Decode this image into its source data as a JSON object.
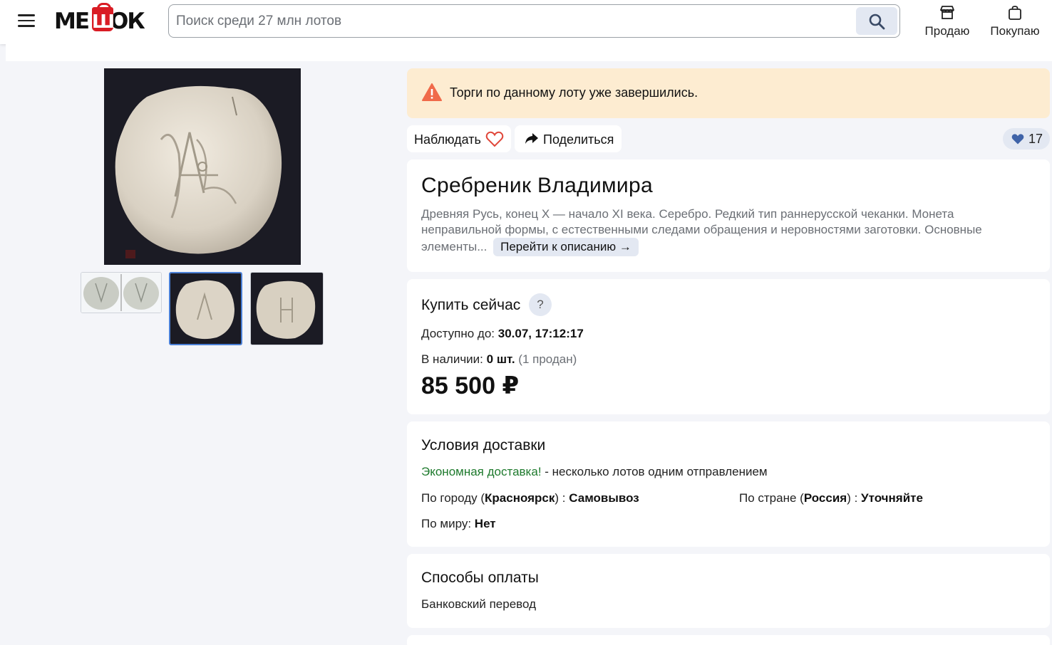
{
  "header": {
    "logo": "МЕШОК",
    "search_placeholder": "Поиск среди 27 млн лотов",
    "sell_label": "Продаю",
    "buy_label": "Покупаю"
  },
  "lot": {
    "alert": "Торги по данному лоту уже завершились.",
    "watch_label": "Наблюдать",
    "share_label": "Поделиться",
    "likes_count": "17",
    "title": "Сребреник Владимира",
    "description": "Древняя Русь, конец X — начало XI века. Серебро. Редкий тип раннерусской чеканки. Монета неправильной формы, с естественными следами обращения и неровностями заготовки. Основные элементы...",
    "description_link": "Перейти к описанию →"
  },
  "buy_now": {
    "heading": "Купить сейчас",
    "help": "?",
    "available_until_label": "Доступно до:",
    "available_until_value": "30.07, 17:12:17",
    "in_stock_label": "В наличии:",
    "in_stock_value": "0 шт.",
    "sold_note": "(1 продан)",
    "price": "85 500 ₽"
  },
  "delivery": {
    "heading": "Условия доставки",
    "economy_highlight": "Экономная доставка!",
    "economy_rest": " - несколько лотов одним отправлением",
    "city_prefix": "По городу (",
    "city_name": "Красноярск",
    "city_suffix": ") : ",
    "city_value": "Самовывоз",
    "country_prefix": "По стране (",
    "country_name": "Россия",
    "country_suffix": ") : ",
    "country_value": "Уточняйте",
    "world_label": "По миру: ",
    "world_value": "Нет"
  },
  "payment": {
    "heading": "Способы оплаты",
    "method": "Банковский перевод"
  },
  "colors": {
    "accent_bag": "#d91c24",
    "alert_bg": "#fdecd1",
    "alert_icon": "#f06a4a",
    "heart_outline": "#e0473a",
    "likes_heart": "#3f63a8",
    "green_text": "#1e7a2d",
    "active_thumb_border": "#4a7fd6"
  },
  "icons": [
    "menu-icon",
    "search-icon",
    "store-icon",
    "bag-icon",
    "warning-icon",
    "heart-outline-icon",
    "share-arrow-icon",
    "heart-filled-icon",
    "arrow-right-icon"
  ]
}
